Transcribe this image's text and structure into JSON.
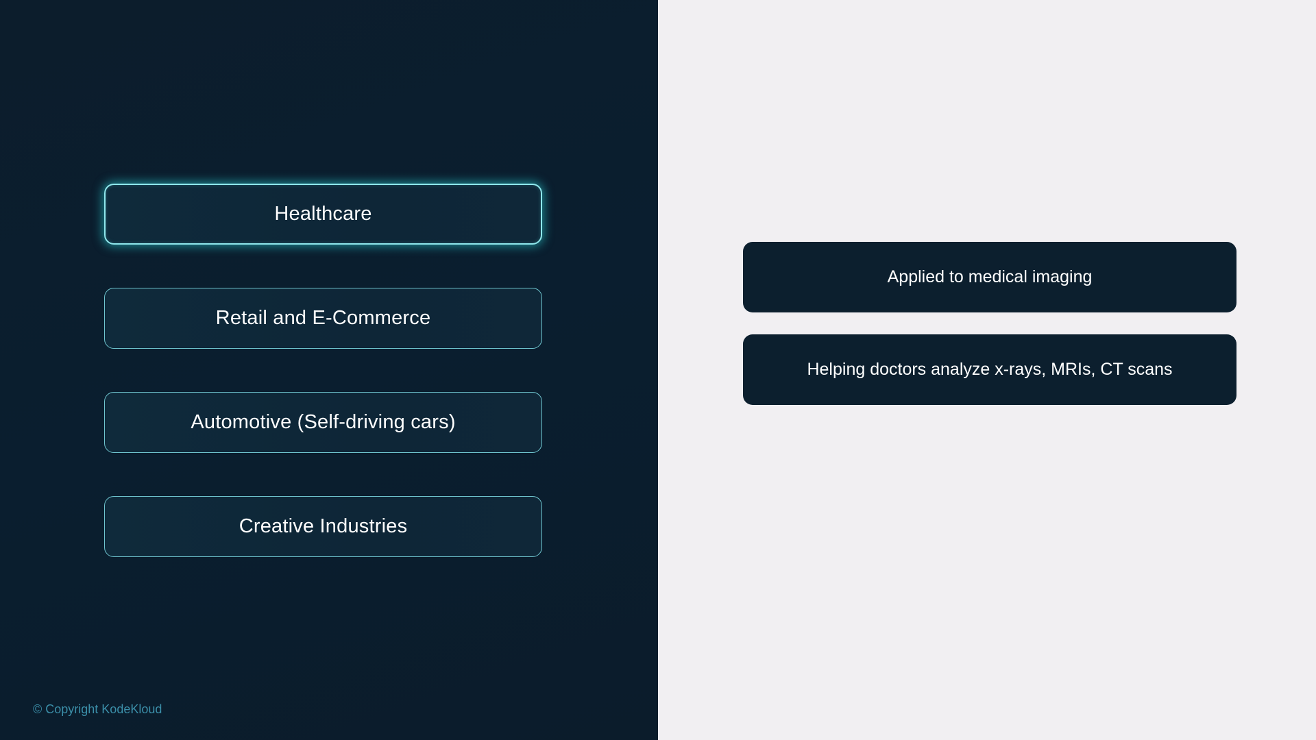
{
  "categories": [
    {
      "label": "Healthcare",
      "active": true
    },
    {
      "label": "Retail and E-Commerce",
      "active": false
    },
    {
      "label": "Automotive (Self-driving cars)",
      "active": false
    },
    {
      "label": "Creative Industries",
      "active": false
    }
  ],
  "details": [
    {
      "text": "Applied to medical imaging"
    },
    {
      "text": "Helping doctors analyze x-rays, MRIs, CT scans"
    }
  ],
  "footer": {
    "copyright": "© Copyright KodeKloud"
  },
  "colors": {
    "left_background": "#0b1d2c",
    "right_background": "#f1eff2",
    "accent_glow": "#28cdd2",
    "card_background": "#0c1f2e",
    "copyright_text": "#3b8fa9"
  }
}
